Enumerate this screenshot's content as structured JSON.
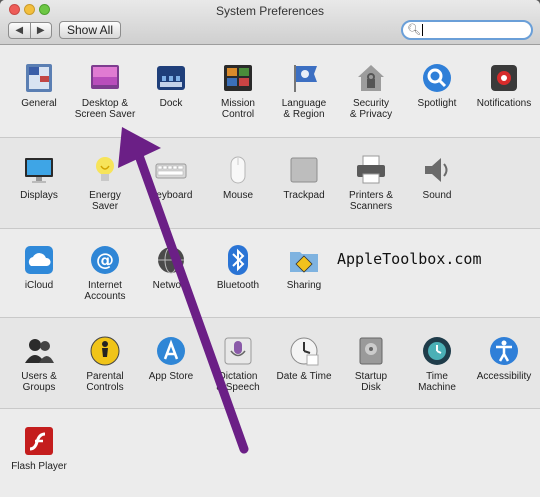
{
  "window": {
    "title": "System Preferences"
  },
  "toolbar": {
    "back_label": "◀",
    "forward_label": "▶",
    "show_all_label": "Show All"
  },
  "search": {
    "value": ""
  },
  "watermark": "AppleToolbox.com",
  "rows": [
    [
      {
        "name": "general",
        "label": "General",
        "icon": "general-icon"
      },
      {
        "name": "desktop",
        "label": "Desktop &\nScreen Saver",
        "icon": "desktop-icon"
      },
      {
        "name": "dock",
        "label": "Dock",
        "icon": "dock-icon"
      },
      {
        "name": "mission-control",
        "label": "Mission\nControl",
        "icon": "mission-control-icon"
      },
      {
        "name": "language",
        "label": "Language\n& Region",
        "icon": "flag-icon"
      },
      {
        "name": "security",
        "label": "Security\n& Privacy",
        "icon": "house-lock-icon"
      },
      {
        "name": "spotlight",
        "label": "Spotlight",
        "icon": "magnifier-icon"
      },
      {
        "name": "notifications",
        "label": "Notifications",
        "icon": "notifications-icon"
      }
    ],
    [
      {
        "name": "displays",
        "label": "Displays",
        "icon": "monitor-icon"
      },
      {
        "name": "energy",
        "label": "Energy\nSaver",
        "icon": "bulb-icon"
      },
      {
        "name": "keyboard",
        "label": "Keyboard",
        "icon": "keyboard-icon"
      },
      {
        "name": "mouse",
        "label": "Mouse",
        "icon": "mouse-icon"
      },
      {
        "name": "trackpad",
        "label": "Trackpad",
        "icon": "trackpad-icon"
      },
      {
        "name": "printers",
        "label": "Printers &\nScanners",
        "icon": "printer-icon"
      },
      {
        "name": "sound",
        "label": "Sound",
        "icon": "speaker-icon"
      }
    ],
    [
      {
        "name": "icloud",
        "label": "iCloud",
        "icon": "cloud-icon"
      },
      {
        "name": "internet-accounts",
        "label": "Internet\nAccounts",
        "icon": "at-icon"
      },
      {
        "name": "network",
        "label": "Network",
        "icon": "globe-icon"
      },
      {
        "name": "bluetooth",
        "label": "Bluetooth",
        "icon": "bluetooth-icon"
      },
      {
        "name": "sharing",
        "label": "Sharing",
        "icon": "folder-sign-icon"
      }
    ],
    [
      {
        "name": "users-groups",
        "label": "Users &\nGroups",
        "icon": "users-icon"
      },
      {
        "name": "parental-controls",
        "label": "Parental\nControls",
        "icon": "parental-icon"
      },
      {
        "name": "app-store",
        "label": "App Store",
        "icon": "app-store-icon"
      },
      {
        "name": "dictation",
        "label": "Dictation\n& Speech",
        "icon": "microphone-icon"
      },
      {
        "name": "date-time",
        "label": "Date & Time",
        "icon": "clock-icon"
      },
      {
        "name": "startup-disk",
        "label": "Startup\nDisk",
        "icon": "disk-icon"
      },
      {
        "name": "time-machine",
        "label": "Time\nMachine",
        "icon": "time-machine-icon"
      },
      {
        "name": "accessibility",
        "label": "Accessibility",
        "icon": "accessibility-icon"
      }
    ],
    [
      {
        "name": "flash-player",
        "label": "Flash Player",
        "icon": "flash-icon"
      }
    ]
  ],
  "colors": {
    "arrow": "#6b1f86"
  }
}
